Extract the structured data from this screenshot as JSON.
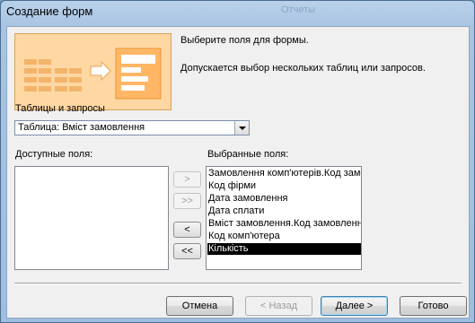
{
  "window": {
    "title": "Создание форм",
    "ghost_title": "Отчеты"
  },
  "header": {
    "instruction": "Выберите поля для формы.",
    "hint": "Допускается выбор нескольких таблиц или запросов."
  },
  "source": {
    "label": "Таблицы и запросы",
    "selected": "Таблица: Вміст замовлення"
  },
  "available": {
    "label": "Доступные поля:",
    "items": []
  },
  "selected_fields": {
    "label": "Выбранные поля:",
    "items": [
      "Замовлення комп'ютерів.Код замо",
      "Код фірми",
      "Дата замовлення",
      "Дата сплати",
      "Вміст замовлення.Код замовлення",
      "Код комп'ютера",
      "Кількість"
    ],
    "selected_index": 6
  },
  "move_buttons": {
    "add": ">",
    "add_all": ">>",
    "remove": "<",
    "remove_all": "<<"
  },
  "footer": {
    "cancel": "Отмена",
    "back": "< Назад",
    "next": "Далее >",
    "finish": "Готово"
  },
  "colors": {
    "graphic_bg": "#ffd49c",
    "graphic_accent": "#f2a64a",
    "selection": "#000000"
  }
}
